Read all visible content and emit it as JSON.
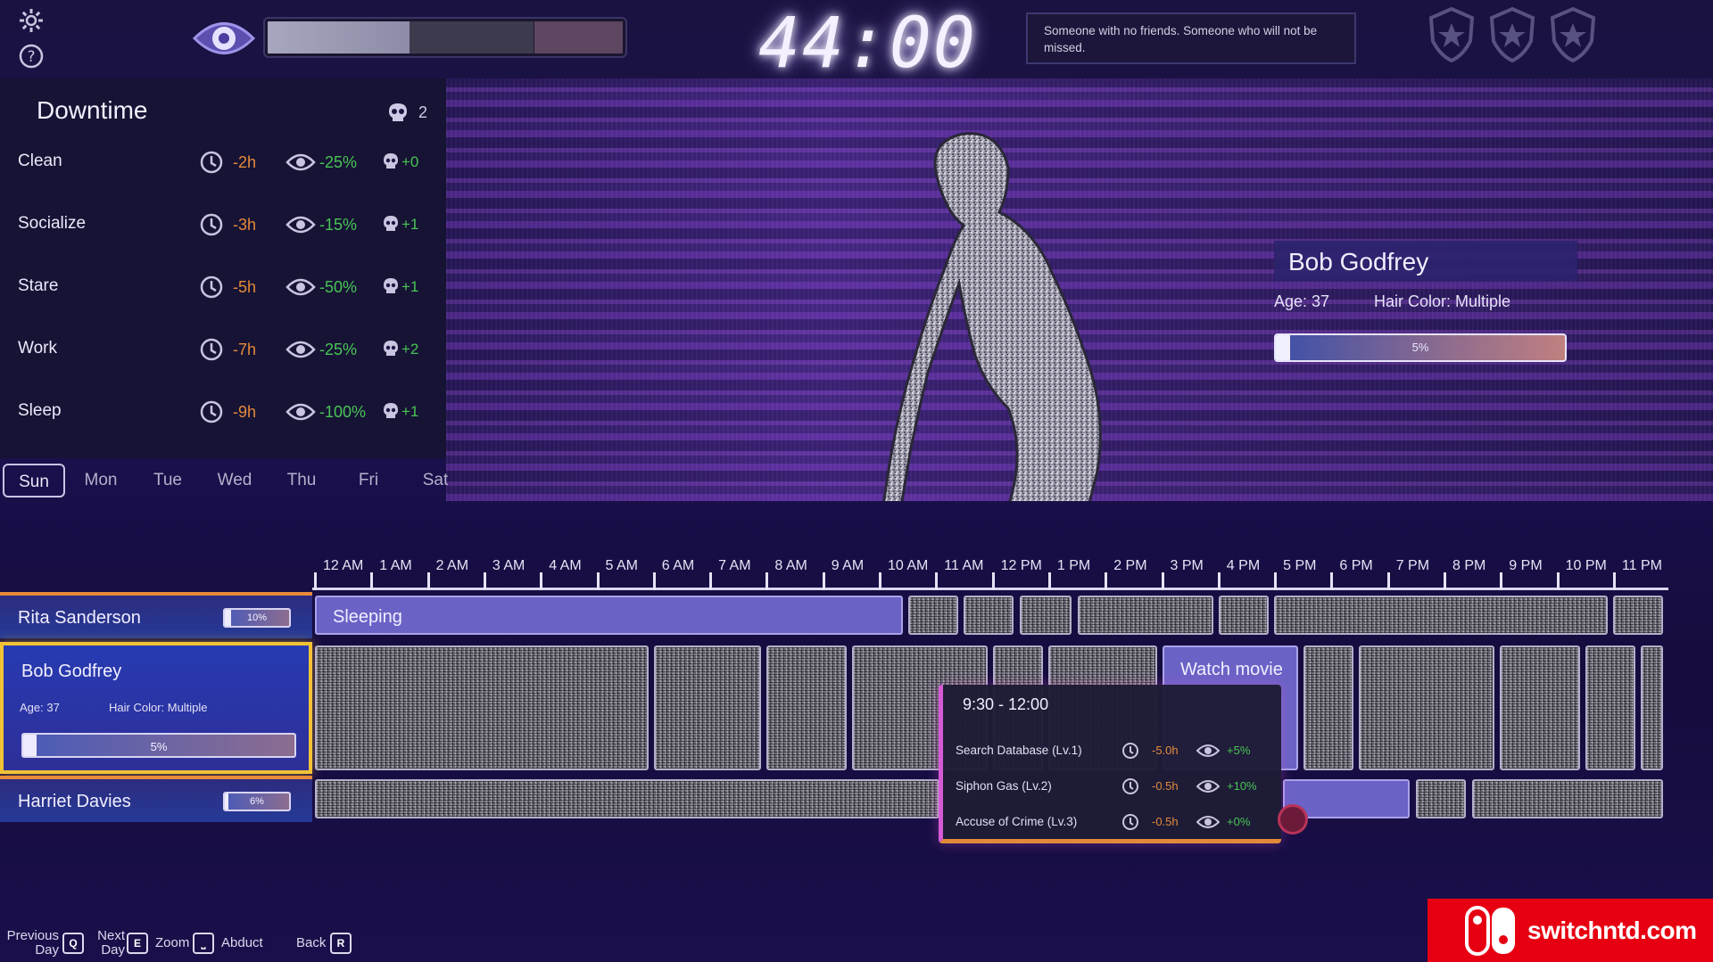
{
  "hud": {
    "timer": "44:00",
    "quote": "Someone with no friends. Someone who will not be missed.",
    "visibility_meter": {
      "light": 0.4,
      "dark": 0.35,
      "alert": 0.25
    },
    "badge_count": 3
  },
  "panel": {
    "title": "Downtime",
    "crime_count": "2",
    "activities": [
      {
        "name": "Clean",
        "time": "-2h",
        "visibility": "-25%",
        "crime": "+0"
      },
      {
        "name": "Socialize",
        "time": "-3h",
        "visibility": "-15%",
        "crime": "+1"
      },
      {
        "name": "Stare",
        "time": "-5h",
        "visibility": "-50%",
        "crime": "+1"
      },
      {
        "name": "Work",
        "time": "-7h",
        "visibility": "-25%",
        "crime": "+2"
      },
      {
        "name": "Sleep",
        "time": "-9h",
        "visibility": "-100%",
        "crime": "+1"
      }
    ]
  },
  "days": [
    "Sun",
    "Mon",
    "Tue",
    "Wed",
    "Thu",
    "Fri",
    "Sat"
  ],
  "active_day": "Sun",
  "profile": {
    "name": "Bob Godfrey",
    "age": "Age: 37",
    "hair": "Hair Color: Multiple",
    "suspicion": "5%",
    "suspicion_value": 0.05
  },
  "hours": [
    "12 AM",
    "1 AM",
    "2 AM",
    "3 AM",
    "4 AM",
    "5 AM",
    "6 AM",
    "7 AM",
    "8 AM",
    "9 AM",
    "10 AM",
    "11 AM",
    "12 PM",
    "1 PM",
    "2 PM",
    "3 PM",
    "4 PM",
    "5 PM",
    "6 PM",
    "7 PM",
    "8 PM",
    "9 PM",
    "10 PM",
    "11 PM"
  ],
  "people": [
    {
      "name": "Rita Sanderson",
      "suspicion": "10%",
      "suspicion_value": 0.1
    },
    {
      "name": "Bob Godfrey",
      "age": "Age: 37",
      "hair": "Hair Color: Multiple",
      "suspicion": "5%",
      "suspicion_value": 0.05
    },
    {
      "name": "Harriet Davies",
      "suspicion": "6%",
      "suspicion_value": 0.06
    }
  ],
  "schedule": {
    "rita_label": "Sleeping",
    "bob_label": "Watch movie"
  },
  "tooltip": {
    "range": "9:30 - 12:00",
    "actions": [
      {
        "name": "Search Database (Lv.1)",
        "time": "-5.0h",
        "visibility": "+5%"
      },
      {
        "name": "Siphon Gas (Lv.2)",
        "time": "-0.5h",
        "visibility": "+10%"
      },
      {
        "name": "Accuse of Crime (Lv.3)",
        "time": "-0.5h",
        "visibility": "+0%"
      }
    ]
  },
  "footer": {
    "prev": "Previous Day",
    "prev_key": "Q",
    "next": "Next Day",
    "next_key": "E",
    "zoom": "Zoom",
    "abduct": "Abduct",
    "back": "Back",
    "back_key": "R"
  },
  "watermark": "switchntd.com",
  "colors": {
    "accent": "#6b62c6",
    "time_cost": "#e58a3b",
    "visibility_good": "#49c455",
    "selected_border": "#f2c236"
  }
}
